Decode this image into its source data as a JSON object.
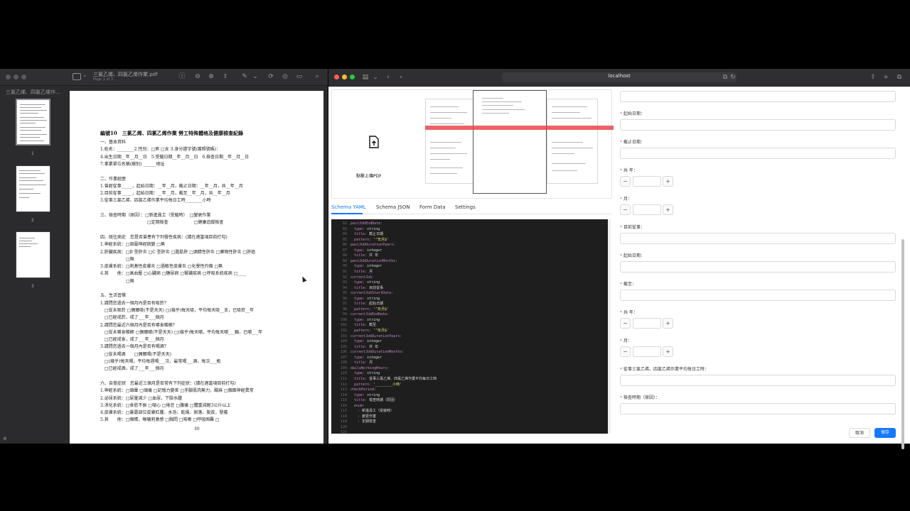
{
  "preview": {
    "doc_title": "三氯乙烯、四氯乙烯作業.pdf",
    "doc_subtitle": "Page 1 of 3",
    "sidebar_title": "三氯乙烯、四氯乙烯作...",
    "thumbnails": [
      "1",
      "2",
      "3"
    ],
    "page_number": "30",
    "page_lines": [
      {
        "t": "編號10　三氯乙烯、四氯乙烯作業 勞工特殊體格及健康檢查紀錄",
        "h": true
      },
      {
        "t": "一、基本資料",
        "h": false
      },
      {
        "t": "1.姓名：________2.性別：□男 □女 3.身分證字號(護照號碼)：",
        "h": false
      },
      {
        "t": "4.出生日期__年__月__日　5.受僱日期__年__月__日　6.檢查日期__年__月__日",
        "h": false
      },
      {
        "t": "7.事業單位名稱(廠別) ______地址",
        "h": false
      },
      {
        "t": "",
        "h": false
      },
      {
        "t": "二、作業經歷",
        "h": false
      },
      {
        "t": "1.曾經從事_____，起始日期：__年__月，截止日期：__年__月，共__年__月",
        "h": false
      },
      {
        "t": "2.目前從事_____，起始日期：__年__月，截至__年__月，共__年__月",
        "h": false
      },
      {
        "t": "3.從事三氯乙烯、四氯乙烯作業平均每日工時________小時",
        "h": false
      },
      {
        "t": "",
        "h": false
      },
      {
        "t": "三、檢查時期（原因）：□新進員工（受僱時）　□變更作業",
        "h": false
      },
      {
        "t": "　　　　　　　　　　　□定期檢查　　　　　　□健康追蹤檢查",
        "h": false
      },
      {
        "t": "",
        "h": false
      },
      {
        "t": "四、既往病史　您是否曾患有下列慢性疾病：(請在適當項目前打勾)",
        "h": false
      },
      {
        "t": "1.神經系統：□周圍神經病變 □無",
        "h": false
      },
      {
        "t": "2.肝臟疾病：□B 型肝炎 □C 型肝炎 □脂肪肝 □酒精性肝炎 □藥物性肝炎 □肝癌",
        "h": false
      },
      {
        "t": "　　　　　　□無",
        "h": false
      },
      {
        "t": "3.皮膚系統：□刺激性皮膚炎 □過敏性皮膚炎 □化學性灼傷 □無",
        "h": false
      },
      {
        "t": "4.其　　他：□高血壓 □心臟病 □糖尿病 □腎臟疾病 □呼吸系統疾病 □____",
        "h": false
      },
      {
        "t": "　　　　　　□無",
        "h": false
      },
      {
        "t": "",
        "h": false
      },
      {
        "t": "五、生活習慣",
        "h": false
      },
      {
        "t": "1.請問您過去一個月內是否有吸菸？",
        "h": false
      },
      {
        "t": "　□從未吸菸 □偶爾吸(不是天天) □(幾乎)每天吸，平均每天吸__支，已吸菸__年",
        "h": false
      },
      {
        "t": "　□已經戒菸，戒了___年___個月",
        "h": false
      },
      {
        "t": "2.請問您最近六個月內是否有嚼食檳榔？",
        "h": false
      },
      {
        "t": "　□從未嚼食檳榔 □偶爾嚼(不是天天) □(幾乎)每天嚼，平均每天嚼___顆，已嚼___年",
        "h": false
      },
      {
        "t": "　□已經戒食，戒了___年___個月",
        "h": false
      },
      {
        "t": "3.請問您過去一個月內是否有喝酒？",
        "h": false
      },
      {
        "t": "　□從未喝酒　　□偶爾喝(不是天天)",
        "h": false
      },
      {
        "t": "　□(幾乎)每天喝，平均每週喝___次，最常喝___酒，每次___瓶",
        "h": false
      },
      {
        "t": "　□已經戒酒，戒了___年___個月",
        "h": false
      },
      {
        "t": "",
        "h": false
      },
      {
        "t": "六、自覺症狀　您最近三個月是否常有下列症狀：(請在適當項目前打勾)",
        "h": false
      },
      {
        "t": "1.神經系統：□頭暈 □頭痛 □記憶力變差 □手腳肌肉無力，酸麻 □顏面神經異常",
        "h": false
      },
      {
        "t": "2.泌尿系統：□尿量減少 □血尿，下肢水腫",
        "h": false
      },
      {
        "t": "3.消化系統：□食慾不振 □噁心 □倦怠 □腹痛 □體重減輕3公斤以上",
        "h": false
      },
      {
        "t": "4.皮膚系統：□暴露部位皮膚紅腫、水泡、乾燥、剝落、脫皮，發癢",
        "h": false
      },
      {
        "t": "5.其　　他：□眼睛，喉嚨刺激感 □胸悶 □咳嗽 □呼吸困難 □",
        "h": false
      }
    ]
  },
  "browser": {
    "address": "localhost"
  },
  "app": {
    "upload_label": "點擊上傳PDF",
    "tabs": [
      "Schema YAML",
      "Schema JSON",
      "Form Data",
      "Settings"
    ],
    "active_tab": "Schema YAML",
    "code_lines": [
      {
        "n": "82",
        "i": 1,
        "p": [
          [
            "k",
            "pastJobEndDate:"
          ]
        ]
      },
      {
        "n": "83",
        "i": 2,
        "p": [
          [
            "k",
            "type: "
          ],
          [
            "w",
            "string"
          ]
        ]
      },
      {
        "n": "84",
        "i": 2,
        "p": [
          [
            "k",
            "title: "
          ],
          [
            "w",
            "截止日期"
          ]
        ]
      },
      {
        "n": "85",
        "i": 2,
        "p": [
          [
            "k",
            "pattern: "
          ],
          [
            "s",
            "'^年月$'"
          ]
        ]
      },
      {
        "n": "86",
        "i": 1,
        "p": [
          [
            "k",
            "pastJobDurationYears:"
          ]
        ]
      },
      {
        "n": "87",
        "i": 2,
        "p": [
          [
            "k",
            "type: "
          ],
          [
            "w",
            "integer"
          ]
        ]
      },
      {
        "n": "88",
        "i": 2,
        "p": [
          [
            "k",
            "title: "
          ],
          [
            "w",
            "共 年"
          ]
        ]
      },
      {
        "n": "89",
        "i": 1,
        "p": [
          [
            "k",
            "pastJobDurationMonths:"
          ]
        ]
      },
      {
        "n": "90",
        "i": 2,
        "p": [
          [
            "k",
            "type: "
          ],
          [
            "w",
            "integer"
          ]
        ]
      },
      {
        "n": "91",
        "i": 2,
        "p": [
          [
            "k",
            "title: "
          ],
          [
            "w",
            "月"
          ]
        ]
      },
      {
        "n": "92",
        "i": 1,
        "p": [
          [
            "k",
            "currentJob:"
          ]
        ]
      },
      {
        "n": "93",
        "i": 2,
        "p": [
          [
            "k",
            "type: "
          ],
          [
            "w",
            "string"
          ]
        ]
      },
      {
        "n": "94",
        "i": 2,
        "p": [
          [
            "k",
            "title: "
          ],
          [
            "w",
            "目前從事"
          ]
        ]
      },
      {
        "n": "95",
        "i": 1,
        "p": [
          [
            "k",
            "currentJobStartDate:"
          ]
        ]
      },
      {
        "n": "96",
        "i": 2,
        "p": [
          [
            "k",
            "type: "
          ],
          [
            "w",
            "string"
          ]
        ]
      },
      {
        "n": "97",
        "i": 2,
        "p": [
          [
            "k",
            "title: "
          ],
          [
            "w",
            "起始日期"
          ]
        ]
      },
      {
        "n": "98",
        "i": 2,
        "p": [
          [
            "k",
            "pattern: "
          ],
          [
            "s",
            "'^年月$'"
          ]
        ]
      },
      {
        "n": "99",
        "i": 1,
        "p": [
          [
            "k",
            "currentJobEndDate:"
          ]
        ]
      },
      {
        "n": "100",
        "i": 2,
        "p": [
          [
            "k",
            "type: "
          ],
          [
            "w",
            "string"
          ]
        ]
      },
      {
        "n": "101",
        "i": 2,
        "p": [
          [
            "k",
            "title: "
          ],
          [
            "w",
            "截至"
          ]
        ]
      },
      {
        "n": "102",
        "i": 2,
        "p": [
          [
            "k",
            "pattern: "
          ],
          [
            "s",
            "'^年月$'"
          ]
        ]
      },
      {
        "n": "103",
        "i": 1,
        "p": [
          [
            "k",
            "currentJobDurationYears:"
          ]
        ]
      },
      {
        "n": "104",
        "i": 2,
        "p": [
          [
            "k",
            "type: "
          ],
          [
            "w",
            "integer"
          ]
        ]
      },
      {
        "n": "105",
        "i": 2,
        "p": [
          [
            "k",
            "title: "
          ],
          [
            "w",
            "共 年"
          ]
        ]
      },
      {
        "n": "106",
        "i": 1,
        "p": [
          [
            "k",
            "currentJobDurationMonths:"
          ]
        ]
      },
      {
        "n": "107",
        "i": 2,
        "p": [
          [
            "k",
            "type: "
          ],
          [
            "w",
            "integer"
          ]
        ]
      },
      {
        "n": "108",
        "i": 2,
        "p": [
          [
            "k",
            "title: "
          ],
          [
            "w",
            "月"
          ]
        ]
      },
      {
        "n": "109",
        "i": 1,
        "p": [
          [
            "k",
            "dailyWorkingHours:"
          ]
        ]
      },
      {
        "n": "110",
        "i": 2,
        "p": [
          [
            "k",
            "type: "
          ],
          [
            "w",
            "string"
          ]
        ]
      },
      {
        "n": "111",
        "i": 2,
        "p": [
          [
            "k",
            "title: "
          ],
          [
            "w",
            "從事三氯乙烯、四氯乙烯作業平均每日工時"
          ]
        ]
      },
      {
        "n": "112",
        "i": 2,
        "p": [
          [
            "k",
            "pattern: "
          ],
          [
            "s",
            "'________小時'"
          ]
        ]
      },
      {
        "n": "113",
        "i": 1,
        "p": [
          [
            "k",
            "checkPeriod:"
          ]
        ]
      },
      {
        "n": "114",
        "i": 2,
        "p": [
          [
            "k",
            "type: "
          ],
          [
            "w",
            "string"
          ]
        ]
      },
      {
        "n": "115",
        "i": 2,
        "p": [
          [
            "k",
            "title: "
          ],
          [
            "w",
            "檢查時期（原因）"
          ]
        ]
      },
      {
        "n": "116",
        "i": 2,
        "p": [
          [
            "k",
            "enum:"
          ]
        ]
      },
      {
        "n": "117",
        "i": 3,
        "p": [
          [
            "w",
            "- 新進員工（受僱時）"
          ]
        ]
      },
      {
        "n": "118",
        "i": 3,
        "p": [
          [
            "w",
            "- 變更作業"
          ]
        ]
      },
      {
        "n": "119",
        "i": 3,
        "p": [
          [
            "w",
            "- 定期檢查"
          ]
        ]
      },
      {
        "n": "120",
        "i": 2,
        "p": [
          [
            "w",
            ""
          ]
        ]
      },
      {
        "n": "121",
        "i": 2,
        "p": [
          [
            "w",
            ""
          ]
        ]
      }
    ],
    "form_fields": [
      {
        "kind": "input",
        "label": null
      },
      {
        "kind": "input",
        "label": "起始日期："
      },
      {
        "kind": "input",
        "label": "截止日期："
      },
      {
        "kind": "stepper",
        "label": "共 年："
      },
      {
        "kind": "stepper",
        "label": "月："
      },
      {
        "kind": "input",
        "label": "目前從事："
      },
      {
        "kind": "input",
        "label": "起始日期："
      },
      {
        "kind": "input",
        "label": "截至："
      },
      {
        "kind": "stepper",
        "label": "共 年："
      },
      {
        "kind": "stepper",
        "label": "月："
      },
      {
        "kind": "input",
        "label": "從事三氯乙烯、四氯乙烯作業平均每日工時："
      },
      {
        "kind": "input",
        "label": "檢查時期（原因）："
      }
    ],
    "stepper_minus": "−",
    "stepper_plus": "+",
    "required_mark": "*",
    "cancel_label": "取消",
    "save_label": "保存"
  }
}
